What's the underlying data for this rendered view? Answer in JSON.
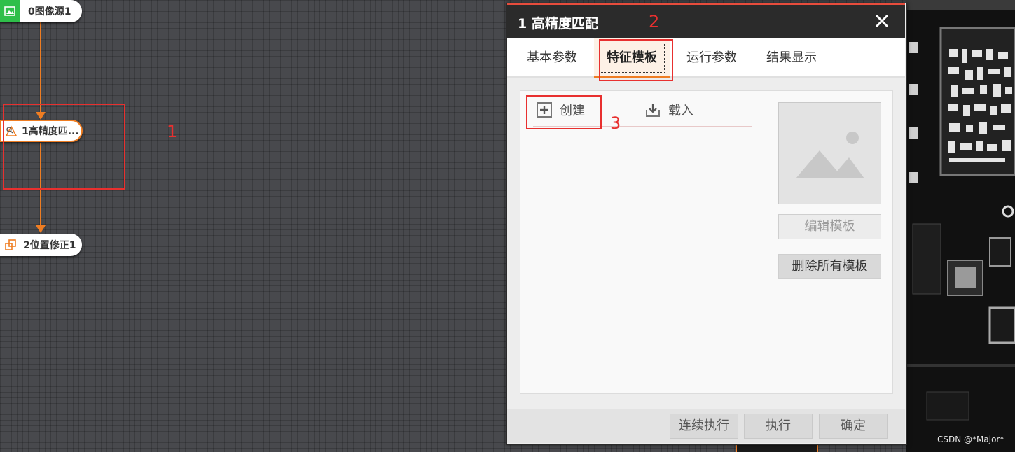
{
  "flow": {
    "nodes": [
      {
        "label": "0图像源1",
        "icon": "image-icon"
      },
      {
        "label": "1高精度匹...",
        "icon": "match-icon"
      },
      {
        "label": "2位置修正1",
        "icon": "position-correct-icon"
      }
    ],
    "annotation_1": "1",
    "connector_color": "#ef7d22"
  },
  "dialog": {
    "title": "1 高精度匹配",
    "annotation_2": "2",
    "annotation_3": "3",
    "tabs": [
      {
        "label": "基本参数",
        "active": false
      },
      {
        "label": "特征模板",
        "active": true
      },
      {
        "label": "运行参数",
        "active": false
      },
      {
        "label": "结果显示",
        "active": false
      }
    ],
    "toolbar": {
      "create_label": "创建",
      "create_icon": "plus-square-icon",
      "load_label": "载入",
      "load_icon": "download-icon"
    },
    "thumbnail_icon": "image-placeholder-icon",
    "side_buttons": {
      "edit_template": "编辑模板",
      "delete_all_templates": "删除所有模板"
    },
    "footer": {
      "continuous_run": "连续执行",
      "run": "执行",
      "confirm": "确定"
    }
  },
  "watermark": "CSDN @*Major*",
  "colors": {
    "accent": "#ef7d22",
    "annotation": "#e8302f",
    "titlebar": "#2b2b2b"
  }
}
